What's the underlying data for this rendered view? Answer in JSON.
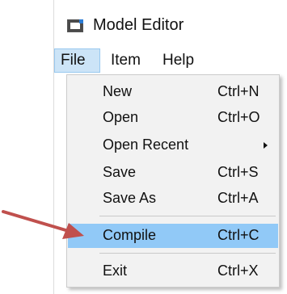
{
  "window": {
    "title": "Model Editor",
    "icon": "window-app-icon"
  },
  "menubar": {
    "items": [
      {
        "label": "File",
        "active": true
      },
      {
        "label": "Item",
        "active": false
      },
      {
        "label": "Help",
        "active": false
      }
    ]
  },
  "file_menu": {
    "items": [
      {
        "label": "New",
        "shortcut": "Ctrl+N"
      },
      {
        "label": "Open",
        "shortcut": "Ctrl+O"
      },
      {
        "label": "Open Recent",
        "shortcut": "",
        "submenu": true
      },
      {
        "label": "Save",
        "shortcut": "Ctrl+S"
      },
      {
        "label": "Save As",
        "shortcut": "Ctrl+A"
      },
      {
        "label": "Compile",
        "shortcut": "Ctrl+C",
        "highlighted": true
      },
      {
        "label": "Exit",
        "shortcut": "Ctrl+X"
      }
    ],
    "highlight_color": "#91c9f7"
  },
  "annotation": {
    "type": "arrow",
    "color": "#c0504d",
    "points_to": "Compile"
  }
}
